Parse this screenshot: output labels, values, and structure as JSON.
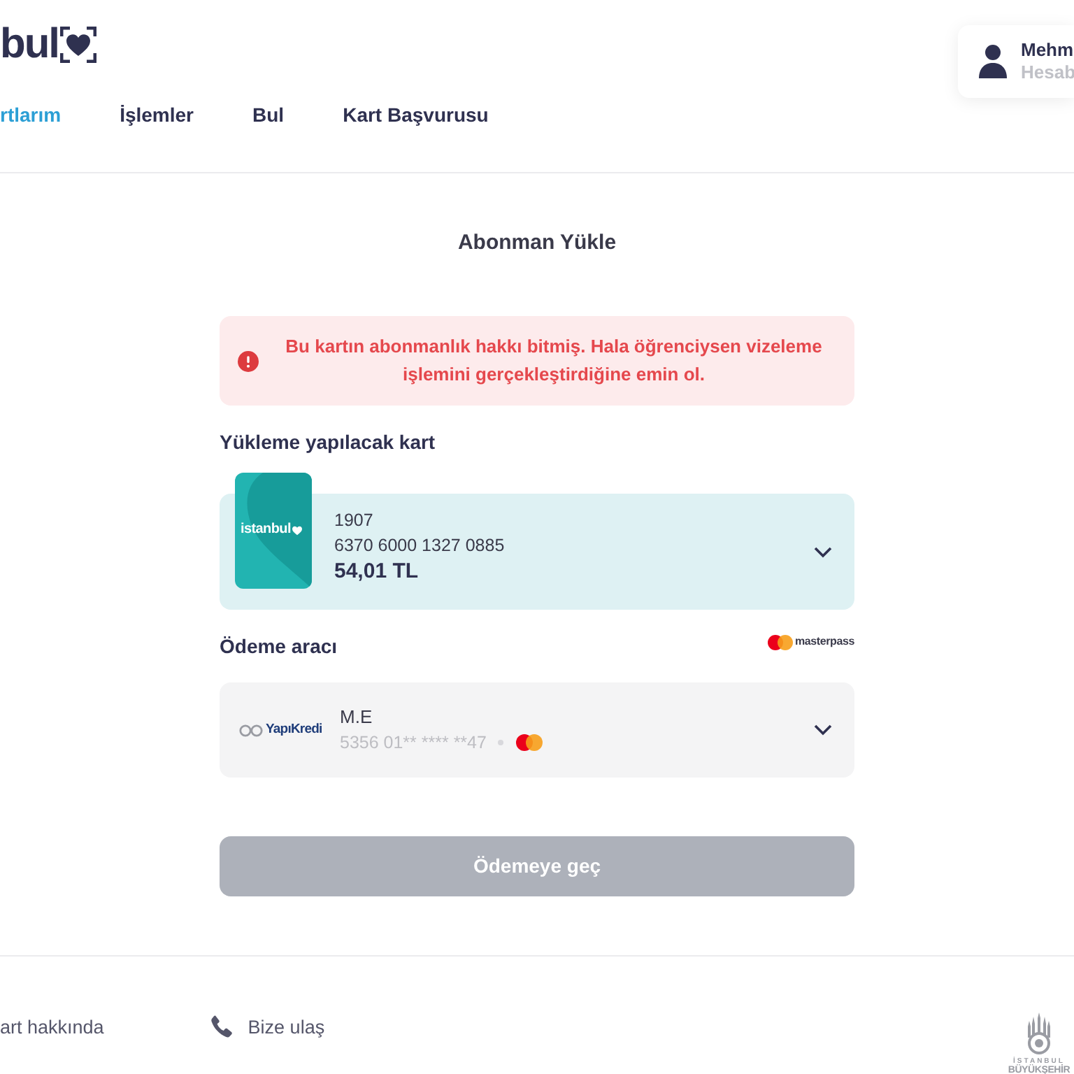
{
  "header": {
    "logo": "bul",
    "nav": [
      {
        "label": "rtlarım",
        "selected": true
      },
      {
        "label": "İşlemler",
        "selected": false
      },
      {
        "label": "Bul",
        "selected": false
      },
      {
        "label": "Kart Başvurusu",
        "selected": false
      }
    ],
    "user": {
      "name": "Mehm",
      "subtitle": "Hesab"
    }
  },
  "page": {
    "title": "Abonman Yükle",
    "alert": {
      "text": "Bu kartın abonmanlık hakkı bitmiş. Hala öğrenciysen vizeleme işlemini gerçekleştirdiğine emin ol."
    },
    "card_section": {
      "label": "Yükleme yapılacak kart",
      "card": {
        "brand": "istanbul",
        "name": "1907",
        "number": "6370 6000 1327 0885",
        "balance": "54,01 TL"
      }
    },
    "payment_section": {
      "label": "Ödeme aracı",
      "provider": "masterpass",
      "method": {
        "bank": "YapıKredi",
        "holder": "M.E",
        "number": "5356 01** **** **47"
      }
    },
    "button": {
      "label": "Ödemeye geç",
      "disabled": true
    }
  },
  "footer": {
    "about": "art hakkında",
    "contact": "Bize ulaş",
    "logo_lines": [
      "İSTANBUL",
      "BÜYÜKŞEHİR"
    ]
  }
}
